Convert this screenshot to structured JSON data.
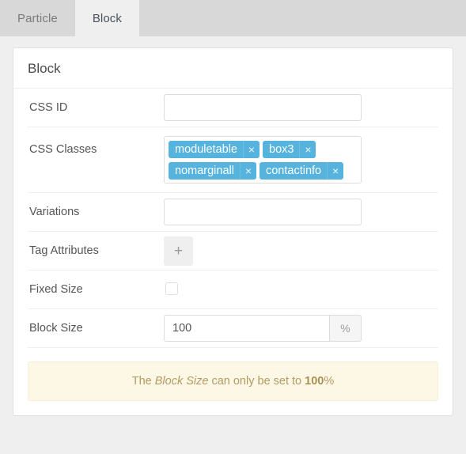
{
  "tabs": [
    {
      "label": "Particle",
      "active": false
    },
    {
      "label": "Block",
      "active": true
    }
  ],
  "panel": {
    "title": "Block"
  },
  "form": {
    "css_id": {
      "label": "CSS ID",
      "value": "",
      "placeholder": ""
    },
    "css_classes": {
      "label": "CSS Classes",
      "chips": [
        {
          "label": "moduletable",
          "remove_icon": "×"
        },
        {
          "label": "box3",
          "remove_icon": "×"
        },
        {
          "label": "nomarginall",
          "remove_icon": "×"
        },
        {
          "label": "contactinfo",
          "remove_icon": "×"
        }
      ]
    },
    "variations": {
      "label": "Variations",
      "value": "",
      "placeholder": ""
    },
    "tag_attributes": {
      "label": "Tag Attributes",
      "add_icon": "+"
    },
    "fixed_size": {
      "label": "Fixed Size",
      "checked": false
    },
    "block_size": {
      "label": "Block Size",
      "value": "100",
      "unit": "%"
    }
  },
  "notice": {
    "text_before": "The ",
    "emphasis": "Block Size",
    "text_middle": " can only be set to ",
    "strong": "100",
    "text_after": "%"
  },
  "colors": {
    "chip_background": "#55b3dd",
    "notice_background": "#fdf8e6",
    "notice_text": "#b29a62",
    "tabstrip_background": "#d8d8d8",
    "body_background": "#efefef"
  }
}
